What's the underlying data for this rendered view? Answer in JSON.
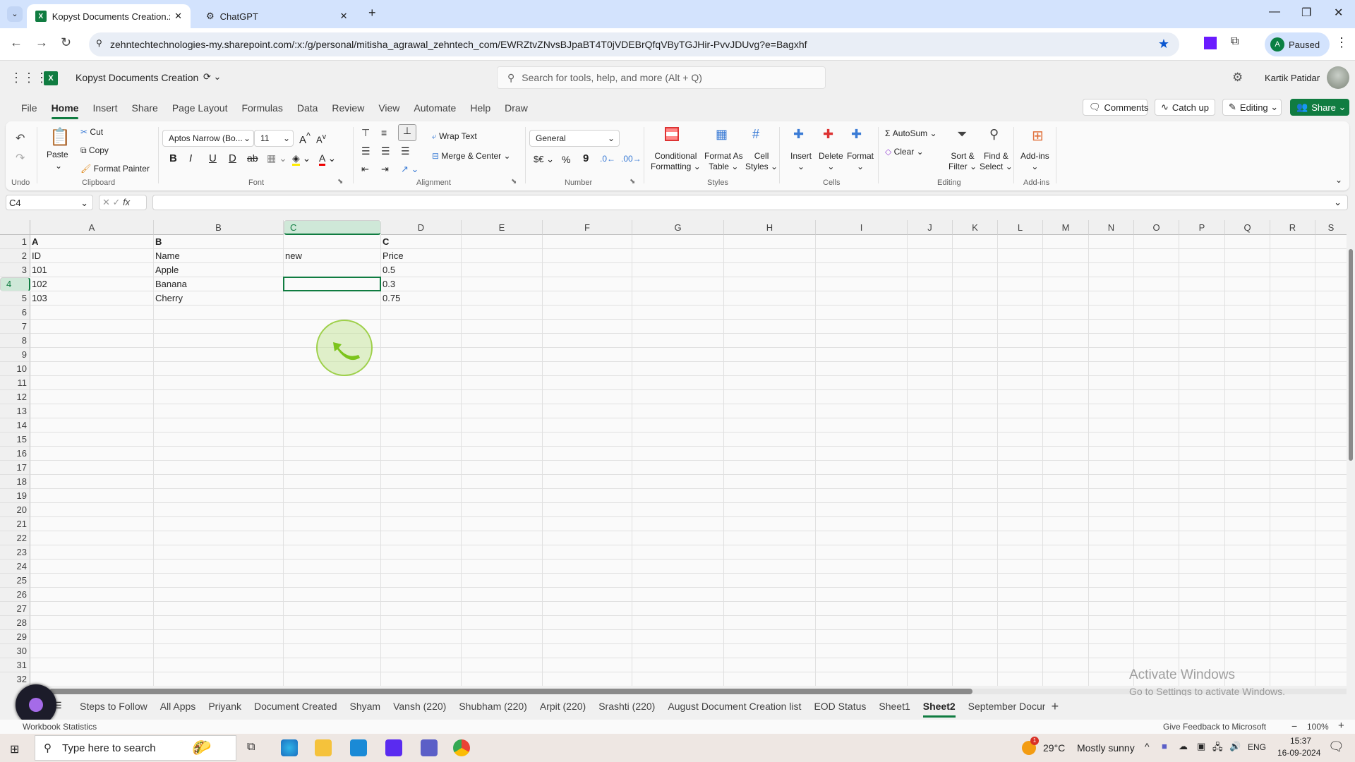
{
  "browser": {
    "tabs": [
      {
        "title": "Kopyst Documents Creation.xlsx",
        "icon": "excel-icon",
        "active": true
      },
      {
        "title": "ChatGPT",
        "icon": "chatgpt-icon",
        "active": false
      }
    ],
    "url": "zehntechtechnologies-my.sharepoint.com/:x:/g/personal/mitisha_agrawal_zehntech_com/EWRZtvZNvsBJpaBT4T0jVDEBrQfqVByTGJHir-PvvJDUvg?e=Bagxhf",
    "profile_initial": "A",
    "profile_status": "Paused"
  },
  "app": {
    "doc_title": "Kopyst Documents Creation",
    "search_placeholder": "Search for tools, help, and more (Alt + Q)",
    "user_name": "Kartik Patidar",
    "menu_tabs": [
      "File",
      "Home",
      "Insert",
      "Share",
      "Page Layout",
      "Formulas",
      "Data",
      "Review",
      "View",
      "Automate",
      "Help",
      "Draw"
    ],
    "active_tab": "Home",
    "header_buttons": {
      "comments": "Comments",
      "catch_up": "Catch up",
      "editing": "Editing",
      "share": "Share"
    }
  },
  "ribbon": {
    "undo_group": "Undo",
    "clipboard": {
      "paste": "Paste",
      "cut": "Cut",
      "copy": "Copy",
      "format_painter": "Format Painter",
      "label": "Clipboard"
    },
    "font": {
      "name": "Aptos Narrow (Bo...",
      "size": "11",
      "label": "Font",
      "bold": "B",
      "italic": "I",
      "underline": "U",
      "double_underline": "D",
      "strike": "ab"
    },
    "alignment": {
      "wrap_text": "Wrap Text",
      "merge_center": "Merge & Center",
      "label": "Alignment"
    },
    "number": {
      "format": "General",
      "currency": "$€",
      "percent": "%",
      "comma": "9",
      "label": "Number"
    },
    "styles": {
      "conditional": "Conditional",
      "conditional2": "Formatting",
      "format_as": "Format As",
      "format_as2": "Table",
      "cell": "Cell",
      "cell2": "Styles",
      "label": "Styles"
    },
    "cells": {
      "insert": "Insert",
      "delete": "Delete",
      "format": "Format",
      "label": "Cells"
    },
    "editing": {
      "autosum": "AutoSum",
      "clear": "Clear",
      "sort": "Sort &",
      "sort2": "Filter",
      "find": "Find &",
      "find2": "Select",
      "label": "Editing"
    },
    "addins": {
      "addins": "Add-ins",
      "label": "Add-ins"
    }
  },
  "formula_bar": {
    "name_box": "C4",
    "formula": ""
  },
  "sheet": {
    "columns": [
      "A",
      "B",
      "C",
      "D",
      "E",
      "F",
      "G",
      "H",
      "I",
      "J",
      "K",
      "L",
      "M",
      "N",
      "O",
      "P",
      "Q",
      "R",
      "S"
    ],
    "selected_column": "C",
    "selected_row": 4,
    "row_count": 32,
    "cells": [
      {
        "r": 1,
        "c": 0,
        "v": "A",
        "bold": true
      },
      {
        "r": 1,
        "c": 1,
        "v": "B",
        "bold": true
      },
      {
        "r": 1,
        "c": 3,
        "v": "C",
        "bold": true
      },
      {
        "r": 2,
        "c": 0,
        "v": "ID"
      },
      {
        "r": 2,
        "c": 1,
        "v": "Name"
      },
      {
        "r": 2,
        "c": 2,
        "v": "new"
      },
      {
        "r": 2,
        "c": 3,
        "v": "Price"
      },
      {
        "r": 3,
        "c": 0,
        "v": "101"
      },
      {
        "r": 3,
        "c": 1,
        "v": "Apple"
      },
      {
        "r": 3,
        "c": 3,
        "v": "0.5"
      },
      {
        "r": 4,
        "c": 0,
        "v": "102"
      },
      {
        "r": 4,
        "c": 1,
        "v": "Banana"
      },
      {
        "r": 4,
        "c": 3,
        "v": "0.3"
      },
      {
        "r": 5,
        "c": 0,
        "v": "103"
      },
      {
        "r": 5,
        "c": 1,
        "v": "Cherry"
      },
      {
        "r": 5,
        "c": 3,
        "v": "0.75"
      }
    ]
  },
  "sheet_tabs": [
    "Steps to Follow",
    "All Apps",
    "Priyank",
    "Document Created",
    "Shyam",
    "Vansh (220)",
    "Shubham (220)",
    "Arpit (220)",
    "Srashti (220)",
    "August Document Creation list",
    "EOD Status",
    "Sheet1",
    "Sheet2",
    "September Docum"
  ],
  "active_sheet": "Sheet2",
  "status_bar": {
    "left": "Workbook Statistics",
    "feedback": "Give Feedback to Microsoft",
    "zoom": "100%"
  },
  "watermark": {
    "title": "Activate Windows",
    "subtitle": "Go to Settings to activate Windows."
  },
  "taskbar": {
    "search_placeholder": "Type here to search",
    "weather_temp": "29°C",
    "weather_desc": "Mostly sunny",
    "lang": "ENG",
    "time": "15:37",
    "date": "16-09-2024",
    "weather_badge": "1"
  }
}
